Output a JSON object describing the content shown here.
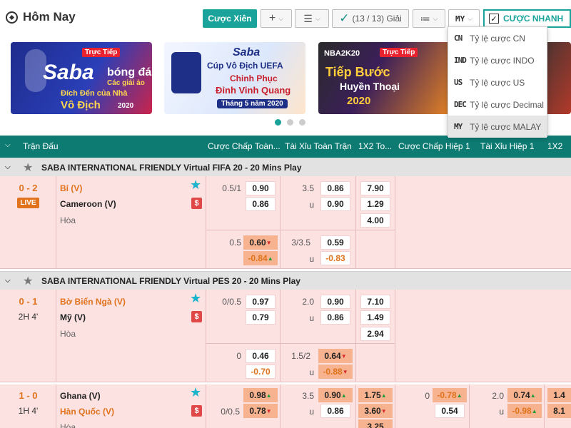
{
  "header": {
    "title": "Hôm Nay",
    "parlay_label": "Cược Xiên",
    "add_label": "+",
    "leagues_label": "(13 / 13) Giải",
    "odds_type_label": "MY",
    "quick_bet_label": "CƯỢC NHANH"
  },
  "banners": [
    {
      "title": "Saba",
      "subtitle": "bóng đá",
      "tag": "Trực Tiếp",
      "line1": "Các giải ảo",
      "line2": "Đích Đến của Nhà",
      "line3": "Vô Địch",
      "year": "2020"
    },
    {
      "title": "Saba",
      "line1": "Cúp Vô Địch UEFA",
      "line2": "Chinh Phục",
      "line3": "Đỉnh Vinh Quang",
      "line4": "Tháng 5 năm 2020"
    },
    {
      "title": "NBA2K20",
      "tag": "Trực Tiếp",
      "line1": "Tiếp Bước",
      "line2": "Huyền Thoại",
      "year": "2020"
    }
  ],
  "odds_menu": [
    {
      "code": "CN",
      "label": "Tỷ lệ cược CN"
    },
    {
      "code": "IND",
      "label": "Tỷ lệ cược INDO"
    },
    {
      "code": "US",
      "label": "Tỷ lệ cược US"
    },
    {
      "code": "DEC",
      "label": "Tỷ lệ cược Decimal"
    },
    {
      "code": "MY",
      "label": "Tỷ lệ cược MALAY"
    }
  ],
  "columns": [
    "Trận Đấu",
    "Cược Chấp Toàn...",
    "Tài Xỉu Toàn Trận",
    "1X2 To...",
    "Cược Chấp Hiệp 1",
    "Tài Xỉu Hiệp 1",
    "1X2"
  ],
  "groups": [
    "SABA INTERNATIONAL FRIENDLY Virtual FIFA 20 - 20 Mins Play",
    "SABA INTERNATIONAL FRIENDLY Virtual PES 20 - 20 Mins Play"
  ],
  "matches": [
    {
      "score": "0 - 2",
      "status": "LIVE",
      "home": "Bỉ (V)",
      "away": "Cameroon (V)",
      "draw": "Hòa",
      "line1": {
        "hdp": "0.5/1",
        "hdp_home": "0.90",
        "hdp_away": "0.86",
        "ou": "3.5",
        "ou_over": "0.86",
        "ou_u": "u",
        "ou_under": "0.90"
      },
      "x12": [
        "7.90",
        "1.29",
        "4.00"
      ],
      "line2": {
        "hdp": "0.5",
        "hdp_home": "0.60",
        "hdp_away": "-0.84",
        "ou": "3/3.5",
        "ou_over": "0.59",
        "ou_u": "u",
        "ou_under": "-0.83"
      }
    },
    {
      "score": "0 - 1",
      "status": "2H 4'",
      "home": "Bờ Biển Ngà (V)",
      "away": "Mỹ (V)",
      "draw": "Hòa",
      "line1": {
        "hdp": "0/0.5",
        "hdp_home": "0.97",
        "hdp_away": "0.79",
        "ou": "2.0",
        "ou_over": "0.90",
        "ou_u": "u",
        "ou_under": "0.86"
      },
      "x12": [
        "7.10",
        "1.49",
        "2.94"
      ],
      "line2": {
        "hdp": "0",
        "hdp_home": "0.46",
        "hdp_away": "-0.70",
        "ou": "1.5/2",
        "ou_over": "0.64",
        "ou_u": "u",
        "ou_under": "-0.88"
      }
    },
    {
      "score": "1 - 0",
      "status": "1H 4'",
      "home": "Ghana (V)",
      "away": "Hàn Quốc (V)",
      "draw": "Hòa",
      "line1": {
        "hdp_home": "0.98",
        "hdp2": "0/0.5",
        "hdp_away": "0.78",
        "ou": "3.5",
        "ou_over": "0.90",
        "ou_u": "u",
        "ou_under": "0.86"
      },
      "x12": [
        "1.75",
        "3.60",
        "3.25"
      ],
      "h1": {
        "hdp": "0",
        "hdp_home": "-0.78",
        "hdp_away": "0.54",
        "ou": "2.0",
        "ou_over": "0.74",
        "ou_u": "u",
        "ou_under": "-0.98",
        "x12_home": "1.4",
        "x12_away": "8.1"
      }
    }
  ],
  "colors": {
    "teal": "#1aa39a",
    "header": "#0e7b73",
    "row_bg": "#fde2e2",
    "orange": "#e0731c"
  }
}
